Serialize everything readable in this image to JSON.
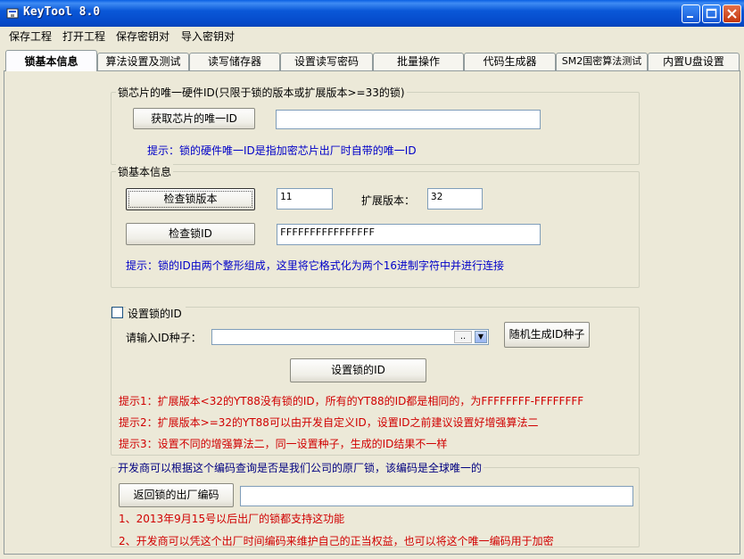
{
  "window": {
    "title": "KeyTool 8.0"
  },
  "menu": {
    "items": [
      "保存工程",
      "打开工程",
      "保存密钥对",
      "导入密钥对"
    ]
  },
  "tabs": [
    "锁基本信息",
    "算法设置及测试",
    "读写储存器",
    "设置读写密码",
    "批量操作",
    "代码生成器",
    "SM2国密算法测试",
    "内置U盘设置"
  ],
  "chip": {
    "legend": "锁芯片的唯一硬件ID(只限于锁的版本或扩展版本>=33的锁)",
    "button": "获取芯片的唯一ID",
    "value": "",
    "hint": "提示：锁的硬件唯一ID是指加密芯片出厂时自带的唯一ID"
  },
  "basic": {
    "legend": "锁基本信息",
    "check_version_button": "检查锁版本",
    "version_value": "11",
    "ext_label": "扩展版本：",
    "ext_value": "32",
    "check_id_button": "检查锁ID",
    "id_value": "FFFFFFFFFFFFFFFF",
    "hint": "提示：锁的ID由两个整形组成，这里将它格式化为两个16进制字符中并进行连接"
  },
  "setid": {
    "legend": "设置锁的ID",
    "checked": false,
    "seed_label": "请输入ID种子：",
    "seed_value": "",
    "combo_dots": "..",
    "random_button": "随机生成ID种子",
    "set_button": "设置锁的ID",
    "hint1": "提示1：扩展版本<32的YT88没有锁的ID，所有的YT88的ID都是相同的，为FFFFFFFF-FFFFFFFF",
    "hint2": "提示2：扩展版本>=32的YT88可以由开发自定义ID，设置ID之前建议设置好增强算法二",
    "hint3": "提示3：设置不同的增强算法二，同一设置种子，生成的ID结果不一样"
  },
  "factory": {
    "legend": "开发商可以根据这个编码查询是否是我们公司的原厂锁，该编码是全球唯一的",
    "button": "返回锁的出厂编码",
    "value": "",
    "note1": "1、2013年9月15号以后出厂的锁都支持这功能",
    "note2": "2、开发商可以凭这个出厂时间编码来维护自己的正当权益，也可以将这个唯一编码用于加密"
  },
  "colors": {
    "title_bar": "#0a58d8",
    "hint_blue": "#0000c8",
    "hint_red": "#d00000",
    "hint_navy": "#000080"
  }
}
